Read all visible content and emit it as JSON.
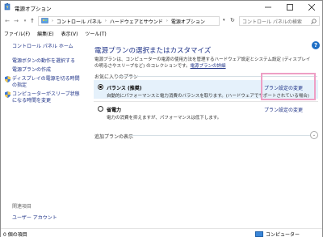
{
  "window": {
    "title": "電源オプション"
  },
  "address": {
    "crumbs": [
      "コントロール パネル",
      "ハードウェアとサウンド",
      "電源オプション"
    ],
    "search_placeholder": "コントロール パネルの検索"
  },
  "menu": [
    "ファイル(F)",
    "編集(E)",
    "表示(V)",
    "ツール(T)"
  ],
  "sidebar": {
    "home": "コントロール パネル ホーム",
    "items": [
      "電源ボタンの動作を選択する",
      "電源プランの作成",
      "ディスプレイの電源を切る時間の指定",
      "コンピューターがスリープ状態になる時間を変更"
    ],
    "related_title": "関連項目",
    "related_items": [
      "ユーザー アカウント"
    ]
  },
  "main": {
    "heading": "電源プランの選択またはカスタマイズ",
    "description": "電源プランは、コンピューターの電源の使用方法を管理するハードウェア設定とシステム設定 (ディスプレイの明るさやスリープなど) のコレクションです。",
    "description_link": "電源プランの詳細",
    "favorites_label": "お気に入りのプラン",
    "plans": [
      {
        "name": "バランス (推奨)",
        "selected": true,
        "description": "自動的にパフォーマンスと電力消費のバランスを取ります。(ハードウェアでサポートされている場合)",
        "link": "プラン設定の変更"
      },
      {
        "name": "省電力",
        "selected": false,
        "description": "電力の消費を抑えますが、パフォーマンスは低下します。",
        "link": "プラン設定の変更"
      }
    ],
    "more_plans_label": "追加プランの表示"
  },
  "status": {
    "items_count": "0 個の項目",
    "location": "コンピューター"
  },
  "colors": {
    "link": "#1e3287",
    "selected_row": "#e5f1fb",
    "highlight_box": "#ee9fc5"
  }
}
